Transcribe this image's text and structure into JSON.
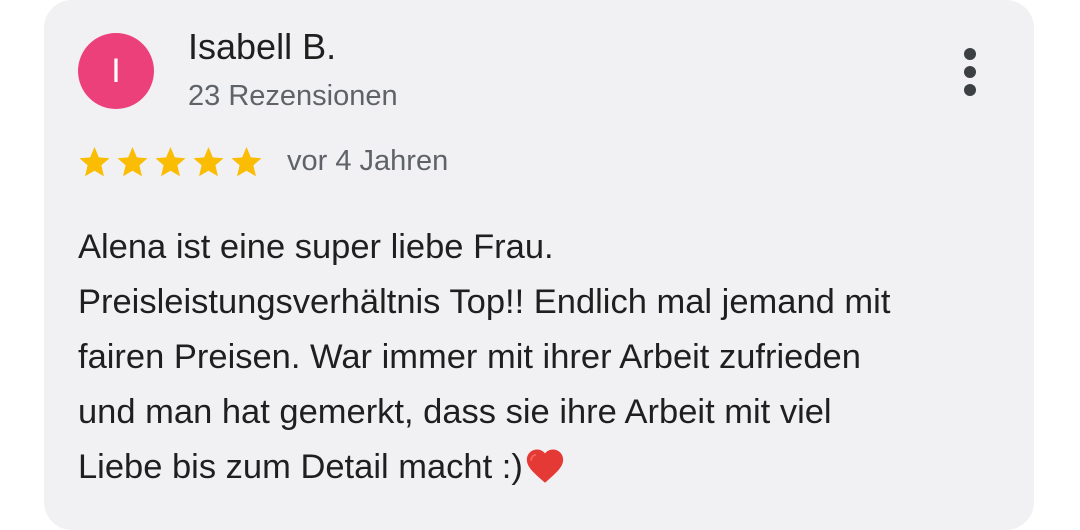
{
  "review": {
    "avatar_letter": "I",
    "avatar_color": "#ec407a",
    "author_name": "Isabell B.",
    "review_count": "23 Rezensionen",
    "menu_icon": "more-vert-icon",
    "rating": 5,
    "rating_max": 5,
    "star_color": "#fbbc04",
    "date": "vor 4 Jahren",
    "text_lines": [
      "Alena ist eine super liebe Frau.",
      "Preisleistungsverhältnis Top!! Endlich mal jemand mit",
      "fairen Preisen. War immer mit ihrer Arbeit zufrieden",
      "und man hat gemerkt, dass sie ihre Arbeit mit viel",
      "Liebe bis zum Detail macht :)"
    ],
    "text_end_emoji": "heart-icon"
  }
}
